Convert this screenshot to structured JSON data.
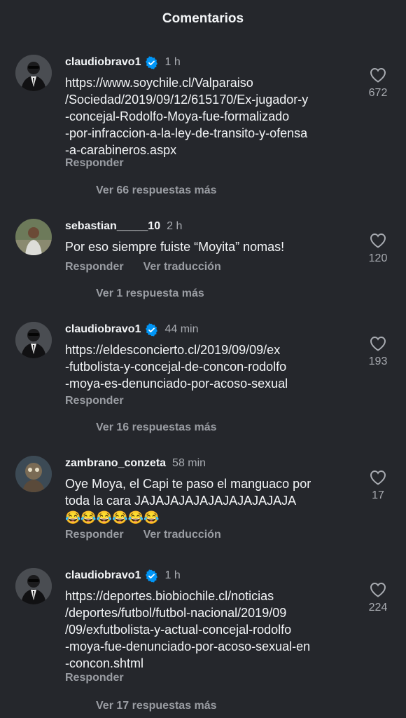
{
  "header": {
    "title": "Comentarios"
  },
  "comments": [
    {
      "username": "claudiobravo1",
      "verified": true,
      "time": "1 h",
      "text": "https://www.soychile.cl/Valparaiso\n/Sociedad/2019/09/12/615170/Ex-jugador-y\n-concejal-Rodolfo-Moya-fue-formalizado\n-por-infraccion-a-la-ley-de-transito-y-ofensa\n-a-carabineros.aspx",
      "reply_label": "Responder",
      "translate_label": "",
      "replies_label": "Ver 66 respuestas más",
      "likes": "672",
      "avatar": "suit-man"
    },
    {
      "username": "sebastian_____10",
      "verified": false,
      "time": "2 h",
      "text": "Por eso siempre fuiste “Moyita” nomas!",
      "reply_label": "Responder",
      "translate_label": "Ver traducción",
      "replies_label": "Ver 1 respuesta más",
      "likes": "120",
      "avatar": "outdoor-person"
    },
    {
      "username": "claudiobravo1",
      "verified": true,
      "time": "44 min",
      "text": "https://eldesconcierto.cl/2019/09/09/ex\n-futbolista-y-concejal-de-concon-rodolfo\n-moya-es-denunciado-por-acoso-sexual",
      "reply_label": "Responder",
      "translate_label": "",
      "replies_label": "Ver 16 respuestas más",
      "likes": "193",
      "avatar": "suit-man"
    },
    {
      "username": "zambrano_conzeta",
      "verified": false,
      "time": "58 min",
      "text": "Oye Moya, el Capi te paso el manguaco por\ntoda la cara JAJAJAJAJAJAJAJAJAJAJA\n😂😂😂😂😂😂",
      "reply_label": "Responder",
      "translate_label": "Ver traducción",
      "replies_label": "",
      "likes": "17",
      "avatar": "cartoon-character"
    },
    {
      "username": "claudiobravo1",
      "verified": true,
      "time": "1 h",
      "text": "https://deportes.biobiochile.cl/noticias\n/deportes/futbol/futbol-nacional/2019/09\n/09/exfutbolista-y-actual-concejal-rodolfo\n-moya-fue-denunciado-por-acoso-sexual-en\n-concon.shtml",
      "reply_label": "Responder",
      "translate_label": "",
      "replies_label": "Ver 17 respuestas más",
      "likes": "224",
      "avatar": "suit-man"
    }
  ],
  "colors": {
    "background": "#25272c",
    "text": "#f3f5f7",
    "secondary": "#9a9da3",
    "verified": "#0095f6"
  }
}
